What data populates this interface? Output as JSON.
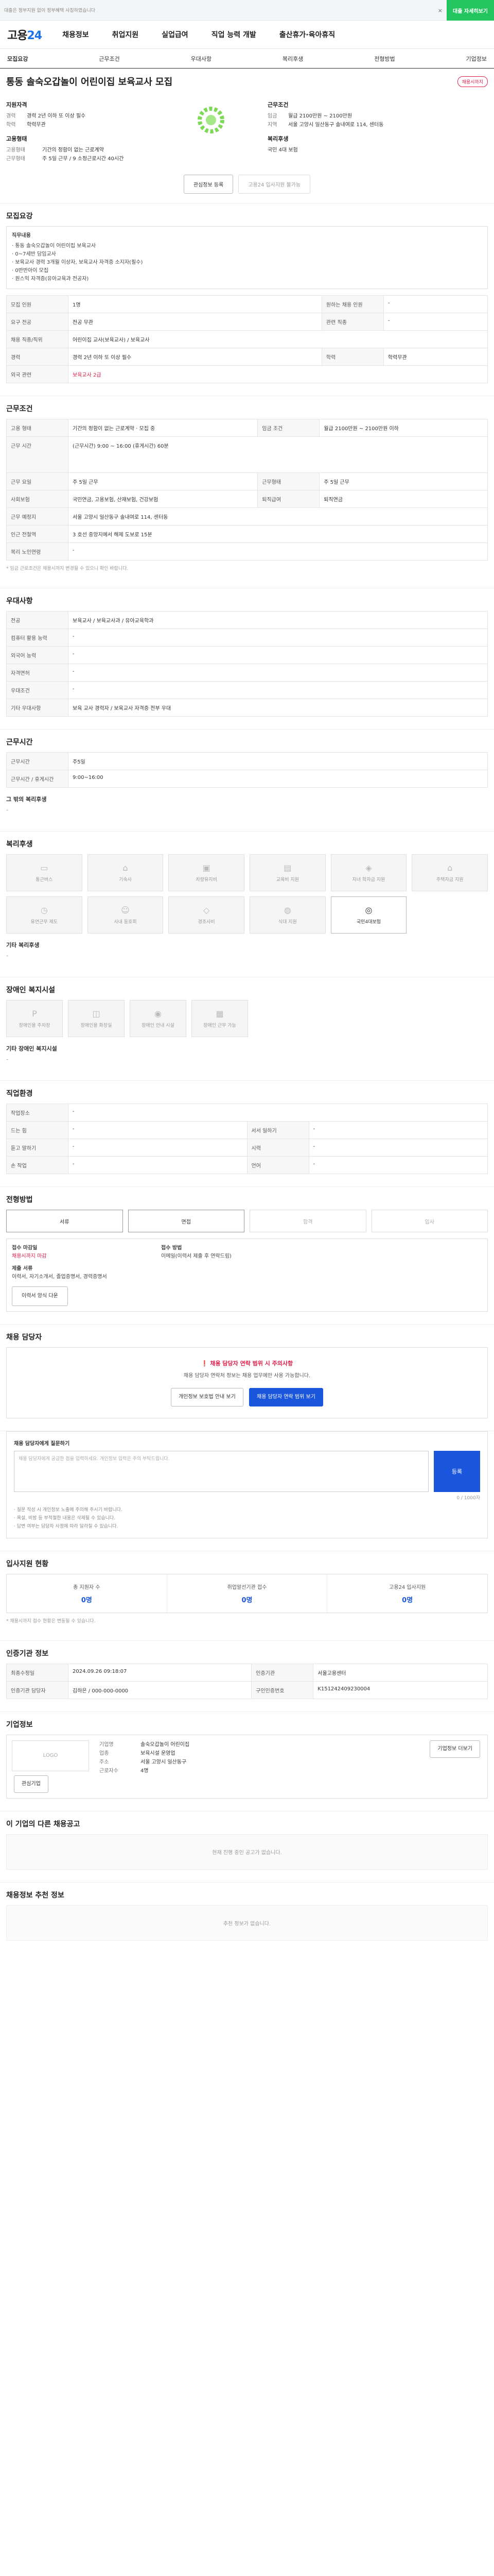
{
  "topbar": {
    "msg": "대출은 정부지원 없이 정부혜택 사칭하였습니다",
    "close": "×",
    "cta": "대출 자세히보기"
  },
  "gnb": {
    "logo_a": "고용",
    "logo_b": "24",
    "items": [
      "채용정보",
      "취업지원",
      "실업급여",
      "직업 능력 개발",
      "출산휴가·육아휴직"
    ]
  },
  "snb": [
    "모집요강",
    "근무조건",
    "우대사항",
    "복리후생",
    "전형방법",
    "기업정보"
  ],
  "head": {
    "title": "통동 솔숙오갑놀이 어린이집 보육교사 모집",
    "badge": "채용시까지",
    "qual_label": "지원자격",
    "qual": [
      [
        "경력",
        "경력 2년 이하 또 이상 필수"
      ],
      [
        "학력",
        "학력무관"
      ]
    ],
    "cond_label": "근무조건",
    "cond": [
      [
        "임금",
        "월급 2100만원 ~ 2100만원"
      ],
      [
        "지역",
        "서울 고양시 일산동구 솔내여로 114, 센터동"
      ]
    ],
    "type_label": "고용형태",
    "type": [
      [
        "고용형태",
        "기간의 정함이 없는 근로계약"
      ],
      [
        "근무형태",
        "주 5일 근무 / 9 소정근로시간 40시간"
      ]
    ],
    "career_label": "복리후생",
    "career": "국민 4대 보험"
  },
  "buttons": {
    "scrap": "관심정보 등록",
    "apply": "고용24 입사지원 불가능"
  },
  "s1": {
    "title": "모집요강",
    "job_label": "직무내용",
    "job": [
      "· 통동 솔숙오갑놀이 어린이집 보육교사",
      "· 0~7세반 담임교사",
      "· 보육교사 경력 3개월 이상자, 보육교사 자격증 소지자(필수)",
      "· 0반반아이 모집",
      "· 원스익 자격증(유아교육과 전공자)"
    ],
    "rows": [
      [
        "모집 인원",
        "1명",
        "원하는 채용 인원",
        "-"
      ],
      [
        "요구 전공",
        "전공 무관",
        "관련 직종",
        "-"
      ],
      [
        "채용 직종/직위",
        "어린이집 교사(보육교사) / 보육교사",
        "",
        ""
      ],
      [
        "경력",
        "경력 2년 이하 또 이상 필수",
        "학력",
        "학력무관"
      ],
      [
        "외국 관련",
        "-",
        "",
        ""
      ]
    ],
    "license": "보육교사 2급"
  },
  "s2": {
    "title": "근무조건",
    "rows": [
      [
        "고용 형태",
        "기간의 정함이 없는 근로계약 · 모집 중",
        "임금 조건",
        "월급 2100만원 ~ 2100만원 이하"
      ],
      [
        "근무 시간",
        "(근무시간) 9:00 ~ 16:00 (휴게시간) 60분",
        "",
        ""
      ],
      [
        "근무 요일",
        "주 5일 근무",
        "근무형태",
        "주 5일 근무"
      ],
      [
        "사회보험",
        "국민연금, 고용보험, 산재보험, 건강보험",
        "퇴직급여",
        "퇴직연금"
      ],
      [
        "근무 예정지",
        "서울 고양시 일산동구 솔내여로 114, 센터동",
        "",
        ""
      ],
      [
        "인근 전철역",
        "3 호선 중앙지에서 해제 도보로 15분",
        "",
        ""
      ],
      [
        "복리 노인연령",
        "-",
        "",
        ""
      ]
    ],
    "note": "* 임금 근로조건은 채용시까지 변경될 수 있으니 확인 바랍니다."
  },
  "s3": {
    "title": "우대사항",
    "rows": [
      [
        "전공",
        "보육교사 / 보육교사과 / 유아교육학과"
      ],
      [
        "컴퓨터 활용 능력",
        "-"
      ],
      [
        "외국어 능력",
        "-"
      ],
      [
        "자격면허",
        "-"
      ],
      [
        "우대조건",
        "-"
      ],
      [
        "기타 우대사항",
        "보육 교사 경력자 / 보육교사 자격증 전부 우대"
      ]
    ]
  },
  "s4": {
    "title": "근무시간",
    "rows": [
      [
        "근무시간",
        "주5일"
      ],
      [
        "근무시간 / 휴게시간",
        "9:00~16:00"
      ]
    ],
    "other_label": "그 밖의 복리후생",
    "other": "-"
  },
  "s5": {
    "title": "복리후생",
    "tiles": [
      "통근버스",
      "기숙사",
      "차량유지비",
      "교육비 지원",
      "자녀 학자금 지원",
      "주택자금 지원",
      "유연근무 제도",
      "사내 동호회",
      "경조사비",
      "식대 지원",
      "국민4대보험",
      ""
    ],
    "etc_label": "기타 복리후생",
    "etc": "-"
  },
  "s6": {
    "title": "장애인 복지시설",
    "tiles": [
      "장애인용 주차장",
      "장애인용 화장실",
      "장애인 안내 시설",
      "장애인 근무 가능"
    ],
    "etc_label": "기타 장애인 복지시설",
    "etc": "-"
  },
  "s7": {
    "title": "직업환경",
    "rows": [
      [
        "작업장소",
        "-",
        "",
        ""
      ],
      [
        "드는 힘",
        "-",
        "서서 일하기",
        "-"
      ],
      [
        "듣고 말하기",
        "-",
        "시력",
        "-"
      ],
      [
        "손 작업",
        "-",
        "언어",
        "-"
      ]
    ]
  },
  "s8": {
    "title": "전형방법",
    "steps": [
      "서류",
      "면접",
      "합격",
      "입사"
    ],
    "method_label": "접수 마감일",
    "method": "채용시까지 마감",
    "doc_label": "제출 서류",
    "doc": "이력서, 자기소개서, 졸업증명서, 경력증명서",
    "apply_label": "접수 방법",
    "apply": "이메일(이력서 제출 후 연락드림)",
    "btn": "이력서 양식 다운"
  },
  "s9": {
    "title": "채용 담당자",
    "warn": "채용 담당자 연락 범위 시 주의사항",
    "desc": "채용 담당자 연락처 정보는 채용 업무에만 사용 가능합니다.",
    "b1": "개인정보 보호법 안내 보기",
    "b2": "채용 담당자 연락 범위 보기"
  },
  "s10": {
    "title": "채용 담당자에게 질문하기",
    "placeholder": "채용 담당자에게 궁금한 점을 입력하세요. 개인정보 입력은 주의 부탁드립니다.",
    "send": "등록",
    "count": "0 / 1000자",
    "bullets": [
      "· 질문 작성 시 개인정보 노출에 주의해 주시기 바랍니다.",
      "· 욕설, 비방 등 부적절한 내용은 삭제될 수 있습니다.",
      "· 답변 여부는 담당자 사정에 따라 달라질 수 있습니다."
    ]
  },
  "s11": {
    "title": "입사지원 현황",
    "stats": [
      [
        "총 지원자 수",
        "0명"
      ],
      [
        "취업알선기관 접수",
        "0명"
      ],
      [
        "고용24 입사지원",
        "0명"
      ]
    ],
    "note": "* 채용시까지 접수 현황은 변동될 수 있습니다."
  },
  "s12": {
    "title": "인증기관 정보",
    "rows": [
      [
        "최종수정일",
        "2024.09.26 09:18:07",
        "인증기관",
        "서울고용센터"
      ],
      [
        "인증기관 담당자",
        "김하은 / 000-000-0000",
        "구인인증번호",
        "K151242409230004"
      ]
    ]
  },
  "s13": {
    "title": "기업정보",
    "logo": "LOGO",
    "rows": [
      [
        "기업명",
        "솔숙오갑놀이 어린이집"
      ],
      [
        "업종",
        "보육시설 운영업"
      ],
      [
        "주소",
        "서울 고양시 일산동구"
      ],
      [
        "근로자수",
        "4명"
      ]
    ],
    "btn1": "관심기업",
    "btn2": "기업정보 더보기"
  },
  "s14": {
    "title": "이 기업의 다른 채용공고",
    "empty": "현재 진행 중인 공고가 없습니다."
  },
  "s15": {
    "title": "채용정보 추천 정보",
    "empty": "추천 정보가 없습니다."
  }
}
